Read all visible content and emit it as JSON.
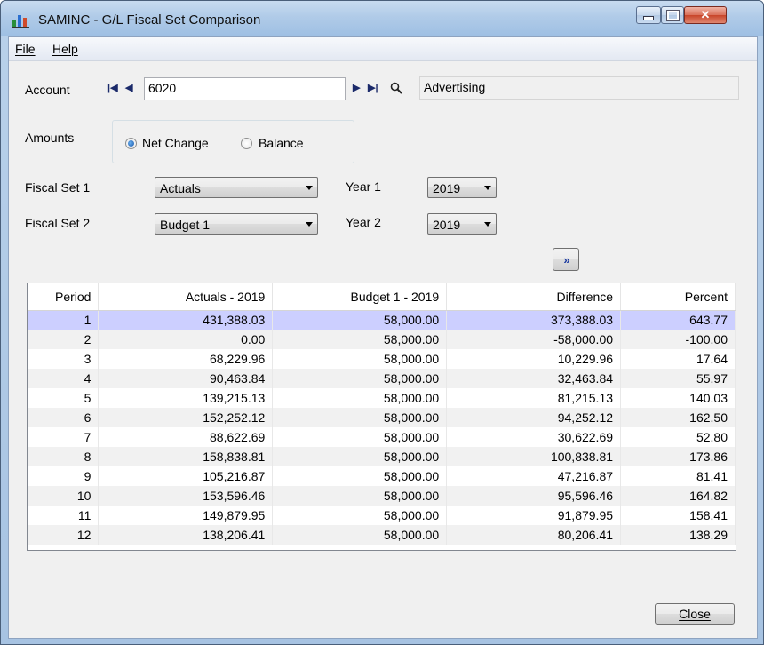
{
  "window": {
    "title": "SAMINC - G/L Fiscal Set Comparison",
    "app_icon": "chart-icon"
  },
  "menu": {
    "file": "File",
    "help": "Help"
  },
  "account": {
    "label": "Account",
    "value": "6020",
    "description": "Advertising"
  },
  "amounts": {
    "label": "Amounts",
    "options": [
      "Net Change",
      "Balance"
    ],
    "selected": "Net Change"
  },
  "fiscal_set_1": {
    "label": "Fiscal Set 1",
    "value": "Actuals",
    "year_label": "Year 1",
    "year": "2019"
  },
  "fiscal_set_2": {
    "label": "Fiscal Set 2",
    "value": "Budget 1",
    "year_label": "Year 2",
    "year": "2019"
  },
  "grid": {
    "columns": [
      "Period",
      "Actuals - 2019",
      "Budget 1 - 2019",
      "Difference",
      "Percent"
    ],
    "rows": [
      [
        "1",
        "431,388.03",
        "58,000.00",
        "373,388.03",
        "643.77"
      ],
      [
        "2",
        "0.00",
        "58,000.00",
        "-58,000.00",
        "-100.00"
      ],
      [
        "3",
        "68,229.96",
        "58,000.00",
        "10,229.96",
        "17.64"
      ],
      [
        "4",
        "90,463.84",
        "58,000.00",
        "32,463.84",
        "55.97"
      ],
      [
        "5",
        "139,215.13",
        "58,000.00",
        "81,215.13",
        "140.03"
      ],
      [
        "6",
        "152,252.12",
        "58,000.00",
        "94,252.12",
        "162.50"
      ],
      [
        "7",
        "88,622.69",
        "58,000.00",
        "30,622.69",
        "52.80"
      ],
      [
        "8",
        "158,838.81",
        "58,000.00",
        "100,838.81",
        "173.86"
      ],
      [
        "9",
        "105,216.87",
        "58,000.00",
        "47,216.87",
        "81.41"
      ],
      [
        "10",
        "153,596.46",
        "58,000.00",
        "95,596.46",
        "164.82"
      ],
      [
        "11",
        "149,879.95",
        "58,000.00",
        "91,879.95",
        "158.41"
      ],
      [
        "12",
        "138,206.41",
        "58,000.00",
        "80,206.41",
        "138.29"
      ]
    ],
    "selected_row": "1"
  },
  "close_button": "Close",
  "colors": {
    "selected_row": "#cccfff",
    "alt_row": "#f1f1f1",
    "titlebar": "#b0cbe8"
  }
}
